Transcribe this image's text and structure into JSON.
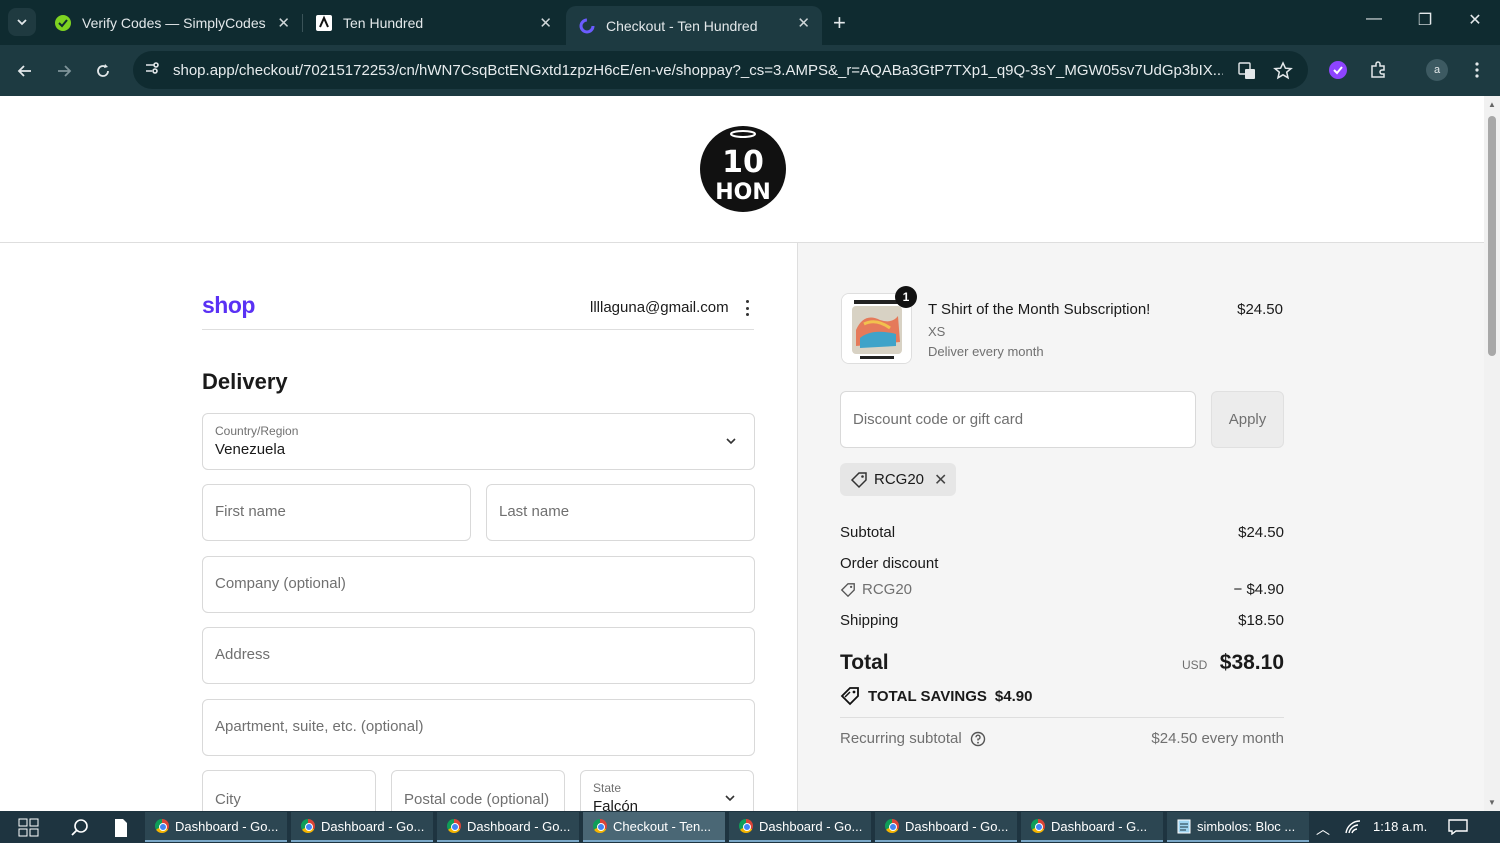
{
  "browser": {
    "tabs": [
      {
        "title": "Verify Codes — SimplyCodes",
        "active": false
      },
      {
        "title": "Ten Hundred",
        "active": false
      },
      {
        "title": "Checkout - Ten Hundred",
        "active": true
      }
    ],
    "url": "shop.app/checkout/70215172253/cn/hWN7CsqBctENGxtd1zpzH6cE/en-ve/shoppay?_cs=3.AMPS&_r=AQABa3GtP7TXp1_q9Q-3sY_MGW05sv7UdGp3bIX...",
    "profile_initial": "a"
  },
  "store": {
    "logo_text_top": "10",
    "logo_text_bottom": "HON"
  },
  "checkout": {
    "shop_logo": "shop",
    "email": "llllaguna@gmail.com",
    "delivery_title": "Delivery",
    "country": {
      "label": "Country/Region",
      "value": "Venezuela"
    },
    "first_name_placeholder": "First name",
    "last_name_placeholder": "Last name",
    "company_placeholder": "Company (optional)",
    "address_placeholder": "Address",
    "apartment_placeholder": "Apartment, suite, etc. (optional)",
    "city_placeholder": "City",
    "postal_placeholder": "Postal code (optional)",
    "state": {
      "label": "State",
      "value": "Falcón"
    }
  },
  "summary": {
    "product": {
      "quantity": "1",
      "title": "T Shirt of the Month Subscription!",
      "variant": "XS",
      "plan": "Deliver every month",
      "price": "$24.50"
    },
    "discount_placeholder": "Discount code or gift card",
    "apply_label": "Apply",
    "applied_code": "RCG20",
    "subtotal_label": "Subtotal",
    "subtotal_value": "$24.50",
    "order_discount_label": "Order discount",
    "discount_code": "RCG20",
    "discount_value": "− $4.90",
    "shipping_label": "Shipping",
    "shipping_value": "$18.50",
    "total_label": "Total",
    "currency": "USD",
    "total_value": "$38.10",
    "savings_label": "TOTAL SAVINGS",
    "savings_value": "$4.90",
    "recurring_label": "Recurring subtotal",
    "recurring_value": "$24.50 every month"
  },
  "taskbar": {
    "items": [
      {
        "label": "Dashboard - Go...",
        "active": false
      },
      {
        "label": "Dashboard - Go...",
        "active": false
      },
      {
        "label": "Dashboard - Go...",
        "active": false
      },
      {
        "label": "Checkout - Ten...",
        "active": true
      },
      {
        "label": "Dashboard - Go...",
        "active": false
      },
      {
        "label": "Dashboard - Go...",
        "active": false
      },
      {
        "label": "Dashboard - G...",
        "active": false
      },
      {
        "label": "simbolos: Bloc ...",
        "active": false
      }
    ],
    "clock": "1:18 a.m."
  },
  "colors": {
    "shop_purple": "#5a31f4",
    "chrome_dark": "#0f2b30",
    "summary_bg": "#f5f5f5"
  }
}
